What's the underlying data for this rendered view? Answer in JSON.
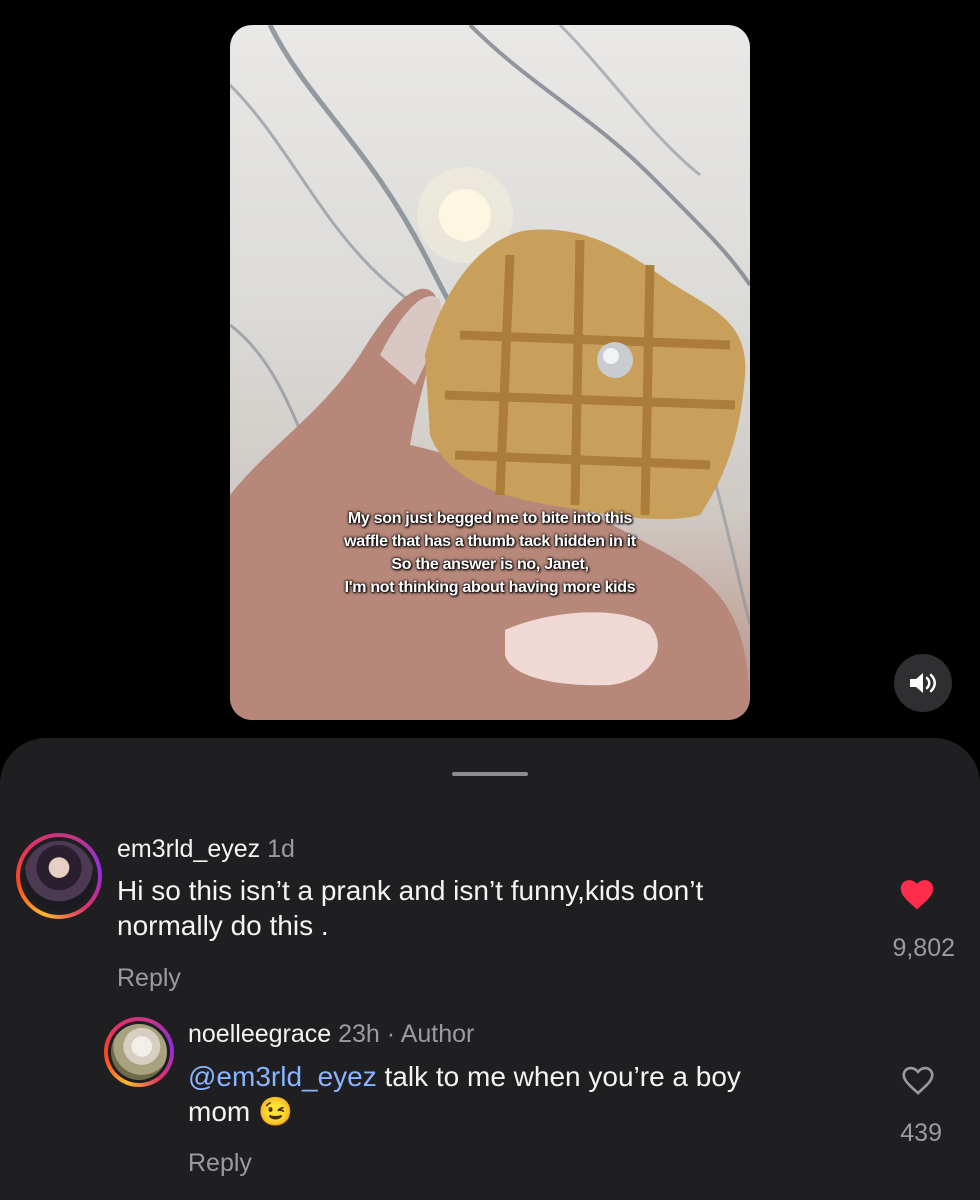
{
  "video": {
    "caption_lines": [
      "My son just begged me to bite into this",
      "waffle that has a thumb tack hidden in it",
      "So the answer is no, Janet,",
      "I'm not thinking about having more kids"
    ],
    "mute_icon": "speaker-icon"
  },
  "comments": [
    {
      "username": "em3rld_eyez",
      "time": "1d",
      "text_line1": "Hi so this isn’t a prank and isn’t funny,kids don’t",
      "text_line2": "normally do this .",
      "likes": "9,802",
      "liked": true,
      "reply_label": "Reply"
    },
    {
      "username": "noelleegrace",
      "time": "23h",
      "separator": "·",
      "author_badge": "Author",
      "mention": "@em3rld_eyez",
      "text_rest": " talk to me when you’re a boy",
      "text_line2": "mom",
      "emoji": "😉",
      "likes": "439",
      "liked": false,
      "reply_label": "Reply"
    }
  ],
  "colors": {
    "like_red": "#ff2d4b",
    "mention_blue": "#8ab4ff",
    "sheet_bg": "#1f1f22"
  }
}
